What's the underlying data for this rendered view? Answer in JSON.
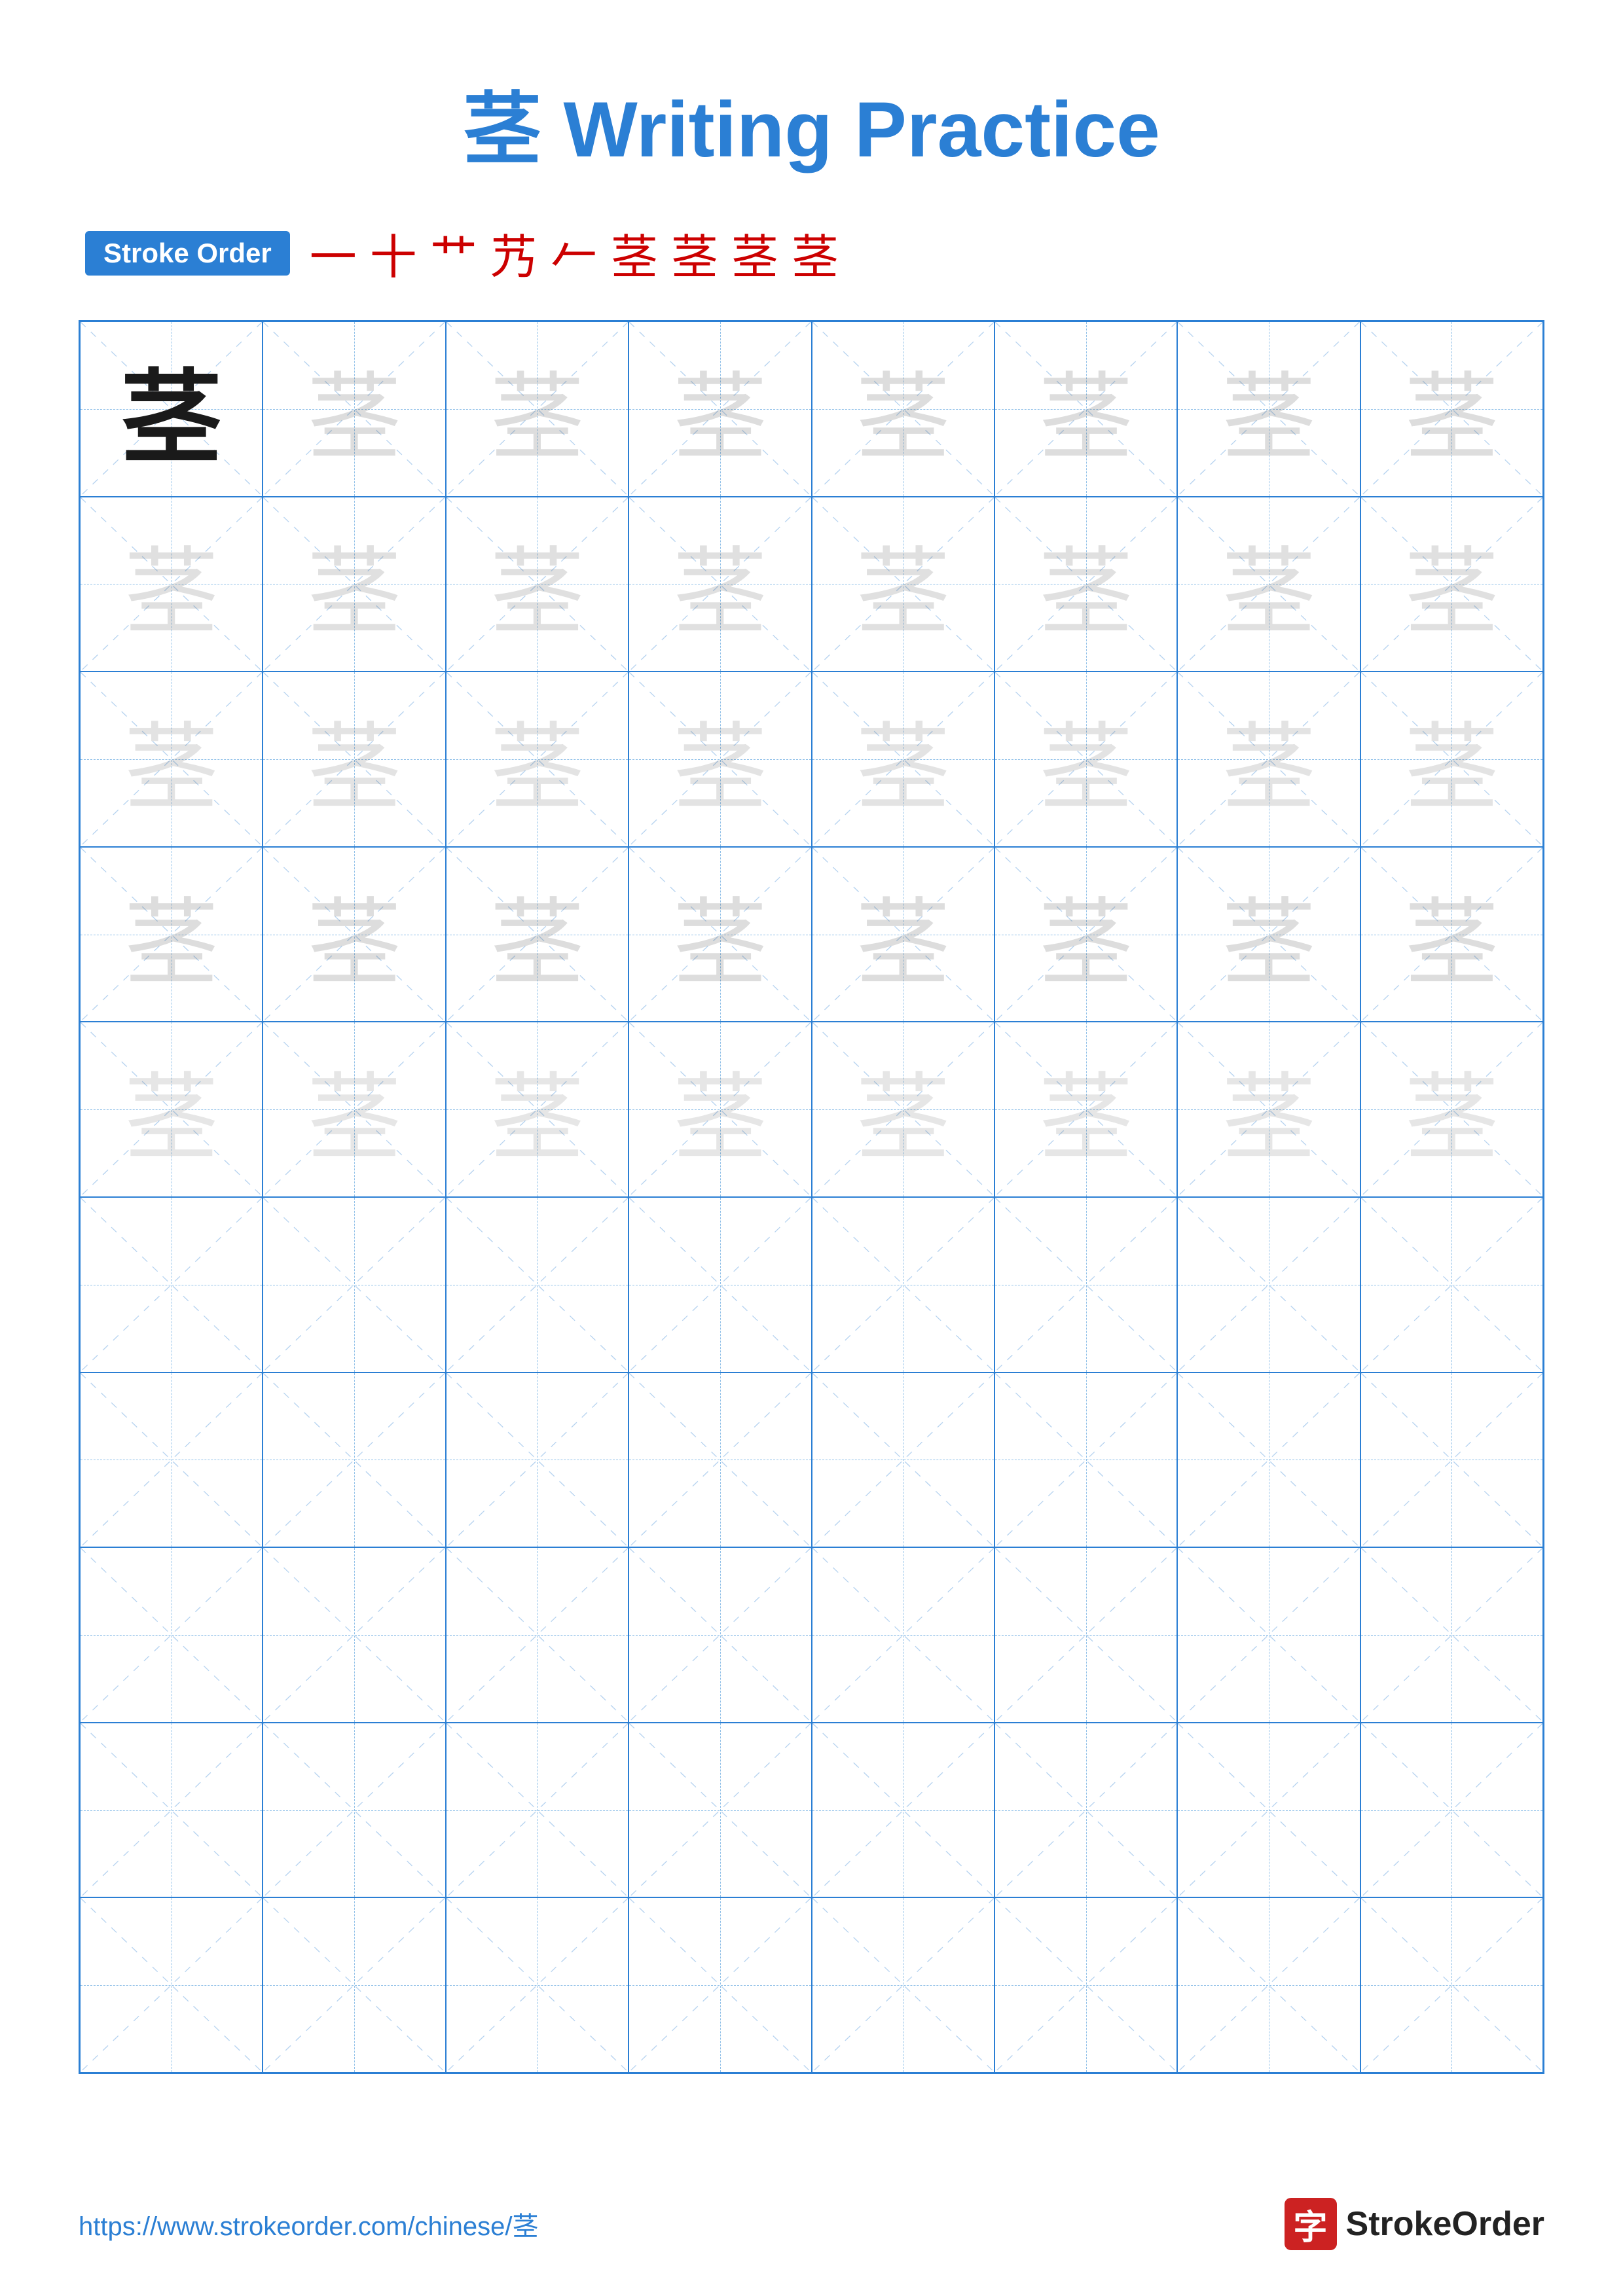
{
  "title": {
    "char": "茎",
    "label": "Writing Practice",
    "full": "茎 Writing Practice"
  },
  "stroke_order": {
    "badge_label": "Stroke Order",
    "chars": [
      "一",
      "十",
      "艹",
      "艿",
      "𠂉",
      "茎",
      "茎",
      "茎",
      "茎"
    ]
  },
  "grid": {
    "cols": 8,
    "rows": 10,
    "practice_char": "茎"
  },
  "footer": {
    "url": "https://www.strokeorder.com/chinese/茎",
    "brand_icon": "字",
    "brand_name": "StrokeOrder"
  }
}
